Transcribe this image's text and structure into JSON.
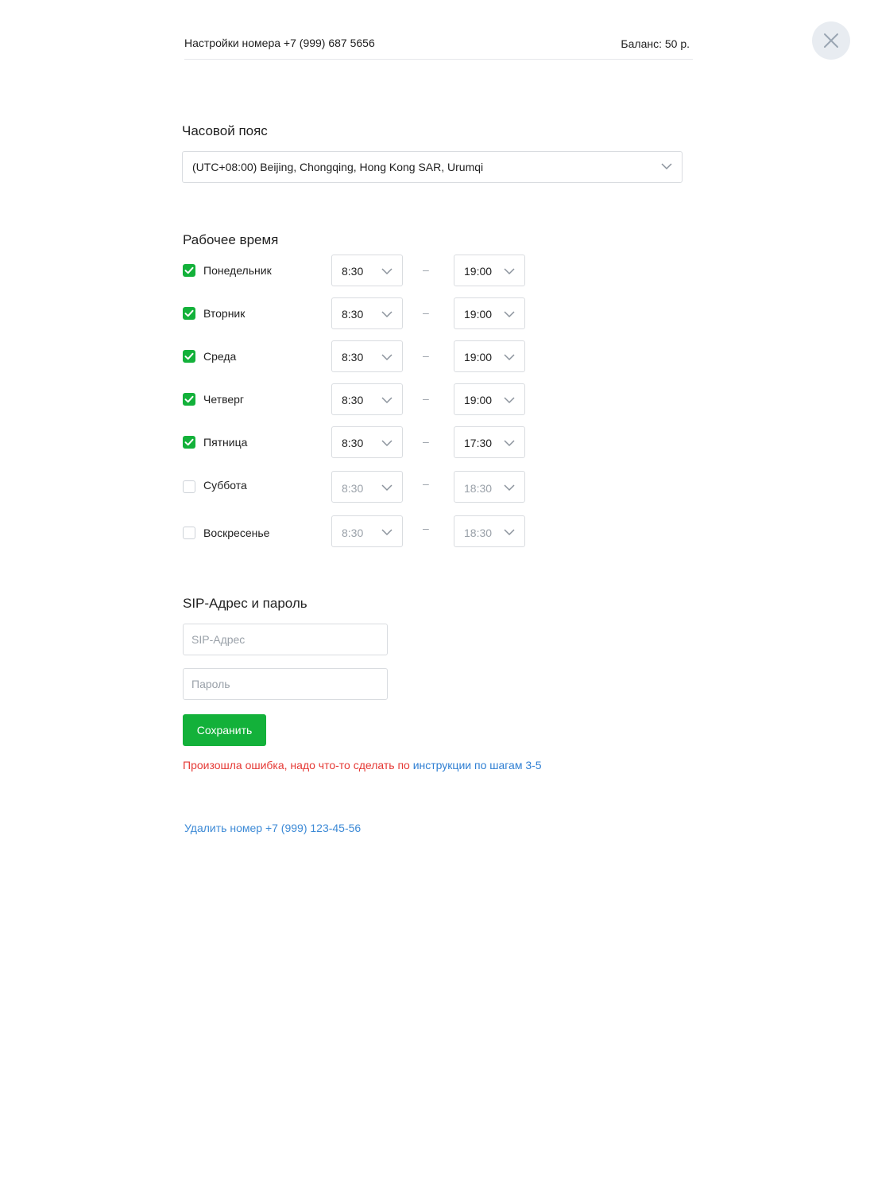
{
  "header": {
    "title": "Настройки номера +7 (999) 687 5656",
    "balance": "Баланс: 50 р."
  },
  "close_icon": "close-icon",
  "timezone": {
    "title": "Часовой пояс",
    "value": "(UTC+08:00) Beijing, Chongqing, Hong Kong SAR, Urumqi"
  },
  "working_hours": {
    "title": "Рабочее время",
    "separator": "–",
    "days": [
      {
        "label": "Понедельник",
        "checked": true,
        "from": "8:30",
        "to": "19:00"
      },
      {
        "label": "Вторник",
        "checked": true,
        "from": "8:30",
        "to": "19:00"
      },
      {
        "label": "Среда",
        "checked": true,
        "from": "8:30",
        "to": "19:00"
      },
      {
        "label": "Четверг",
        "checked": true,
        "from": "8:30",
        "to": "19:00"
      },
      {
        "label": "Пятница",
        "checked": true,
        "from": "8:30",
        "to": "17:30"
      },
      {
        "label": "Суббота",
        "checked": false,
        "from": "8:30",
        "to": "18:30"
      },
      {
        "label": "Воскресенье",
        "checked": false,
        "from": "8:30",
        "to": "18:30"
      }
    ]
  },
  "sip": {
    "title": "SIP-Адрес и пароль",
    "address_value": "",
    "address_placeholder": "SIP-Адрес",
    "password_value": "",
    "password_placeholder": "Пароль",
    "save_label": "Сохранить"
  },
  "error": {
    "text": "Произошла ошибка, надо что-то сделать по ",
    "link": "инструкции по шагам 3-5"
  },
  "delete_label": "Удалить номер +7 (999) 123-45-56",
  "colors": {
    "accent_green": "#13b13a",
    "error_red": "#e53935",
    "link_blue": "#2f7fd3"
  }
}
